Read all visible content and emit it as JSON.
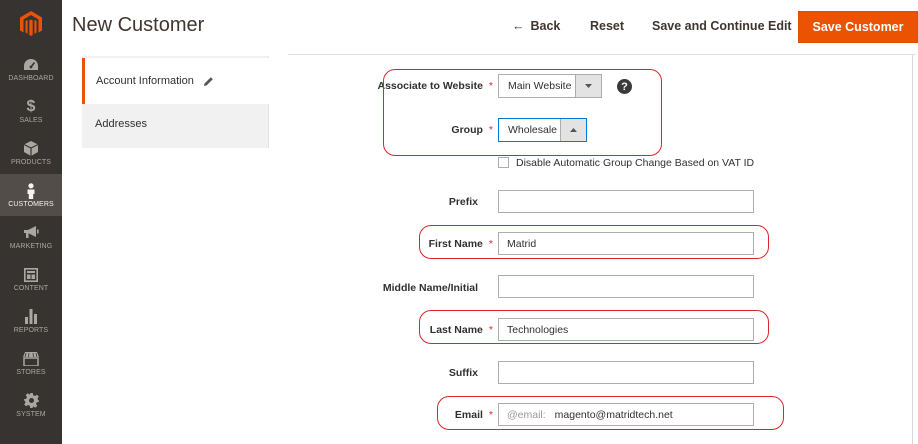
{
  "sidebar": {
    "logo": "magento-logo",
    "items": [
      {
        "label": "DASHBOARD",
        "icon": "dashboard-icon",
        "active": false
      },
      {
        "label": "SALES",
        "icon": "dollar-icon",
        "active": false
      },
      {
        "label": "PRODUCTS",
        "icon": "cube-icon",
        "active": false
      },
      {
        "label": "CUSTOMERS",
        "icon": "person-icon",
        "active": true
      },
      {
        "label": "MARKETING",
        "icon": "megaphone-icon",
        "active": false
      },
      {
        "label": "CONTENT",
        "icon": "layout-icon",
        "active": false
      },
      {
        "label": "REPORTS",
        "icon": "bar-chart-icon",
        "active": false
      },
      {
        "label": "STORES",
        "icon": "storefront-icon",
        "active": false
      },
      {
        "label": "SYSTEM",
        "icon": "gear-icon",
        "active": false
      }
    ]
  },
  "header": {
    "title": "New Customer",
    "back_label": "Back",
    "reset_label": "Reset",
    "continue_label": "Save and Continue Edit",
    "save_label": "Save Customer"
  },
  "tabs": {
    "account": "Account Information",
    "addresses": "Addresses"
  },
  "form": {
    "website": {
      "label": "Associate to Website",
      "value": "Main Website"
    },
    "group": {
      "label": "Group",
      "value": "Wholesale"
    },
    "vat": {
      "label": "Disable Automatic Group Change Based on VAT ID"
    },
    "prefix": {
      "label": "Prefix",
      "value": ""
    },
    "first_name": {
      "label": "First Name",
      "value": "Matrid"
    },
    "middle_name": {
      "label": "Middle Name/Initial",
      "value": ""
    },
    "last_name": {
      "label": "Last Name",
      "value": "Technologies"
    },
    "suffix": {
      "label": "Suffix",
      "value": ""
    },
    "email": {
      "label": "Email",
      "addon": "@email:",
      "value": "magento@matridtech.net"
    }
  },
  "required_marker": "*",
  "colors": {
    "accent": "#eb5202",
    "sidebar": "#373330",
    "highlight": "#d9262c"
  }
}
